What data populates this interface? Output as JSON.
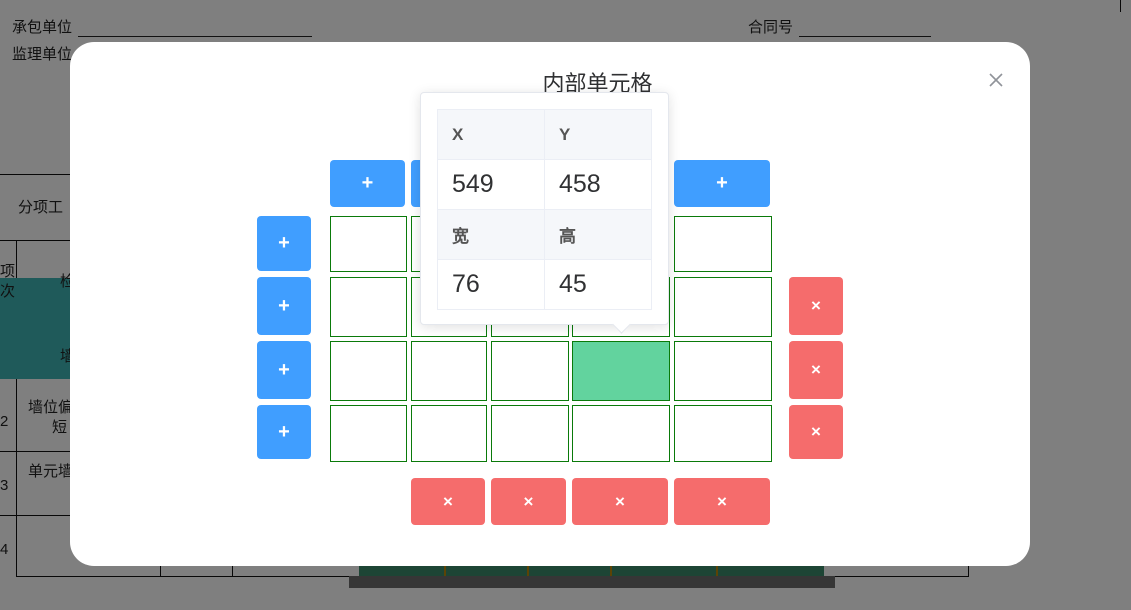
{
  "document": {
    "contractor_label": "承包单位",
    "supervisor_label": "监理单位",
    "contract_no_label": "合同号",
    "section_label": "分项工",
    "row_labels": [
      "检",
      "墙",
      "墙位偏",
      "短",
      "单元墙",
      "3"
    ],
    "left_labels": [
      "项",
      "次",
      "2",
      "3",
      "4"
    ]
  },
  "dialog": {
    "title": "内部单元格",
    "close_icon": "close-icon",
    "add_symbol": "+",
    "delete_symbol": "×",
    "grid": {
      "rows": 4,
      "cols": 5,
      "selected_row": 2,
      "selected_col": 3
    }
  },
  "popover": {
    "x_label": "X",
    "y_label": "Y",
    "x_value": "549",
    "y_value": "458",
    "width_label": "宽",
    "height_label": "高",
    "width_value": "76",
    "height_value": "45"
  },
  "colors": {
    "add_button": "#409eff",
    "delete_button": "#f56c6c",
    "cell_border": "#0a7a0a",
    "selected_cell": "#62d39e",
    "overlay": "rgba(0,0,0,0.5)"
  }
}
